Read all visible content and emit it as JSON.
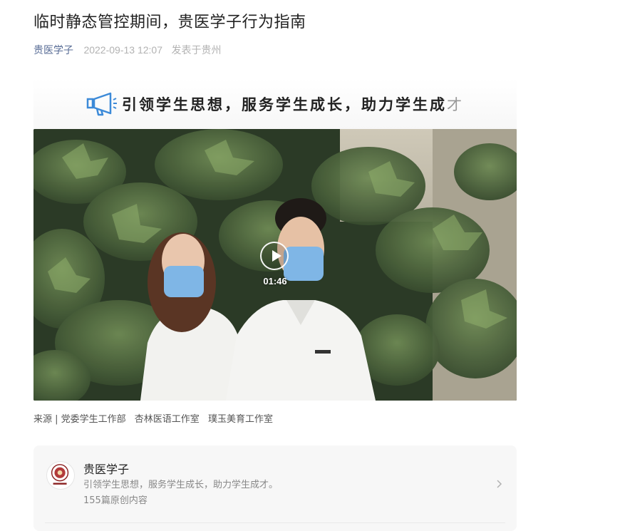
{
  "article": {
    "title": "临时静态管控期间，贵医学子行为指南",
    "author": "贵医学子",
    "date": "2022-09-13 12:07",
    "location": "发表于贵州"
  },
  "banner": {
    "slogan_main": "引领学生思想，服务学生成长，助力学生成",
    "slogan_end": "才",
    "icon": "megaphone-icon"
  },
  "video": {
    "duration": "01:46",
    "icon": "play-icon"
  },
  "source": {
    "prefix": "来源 | 党委学生工作部",
    "studio1": "杏林医语工作室",
    "studio2": "璞玉美育工作室"
  },
  "account_card": {
    "name": "贵医学子",
    "description": "引领学生思想，服务学生成长，助力学生成才。",
    "count": "155篇原创内容",
    "logo_icon": "university-seal-icon",
    "arrow_icon": "chevron-right-icon"
  },
  "colors": {
    "author_link": "#576b95",
    "muted": "#b2b2b2",
    "card_bg": "#f7f7f7",
    "icon_blue": "#3c8ad8"
  }
}
